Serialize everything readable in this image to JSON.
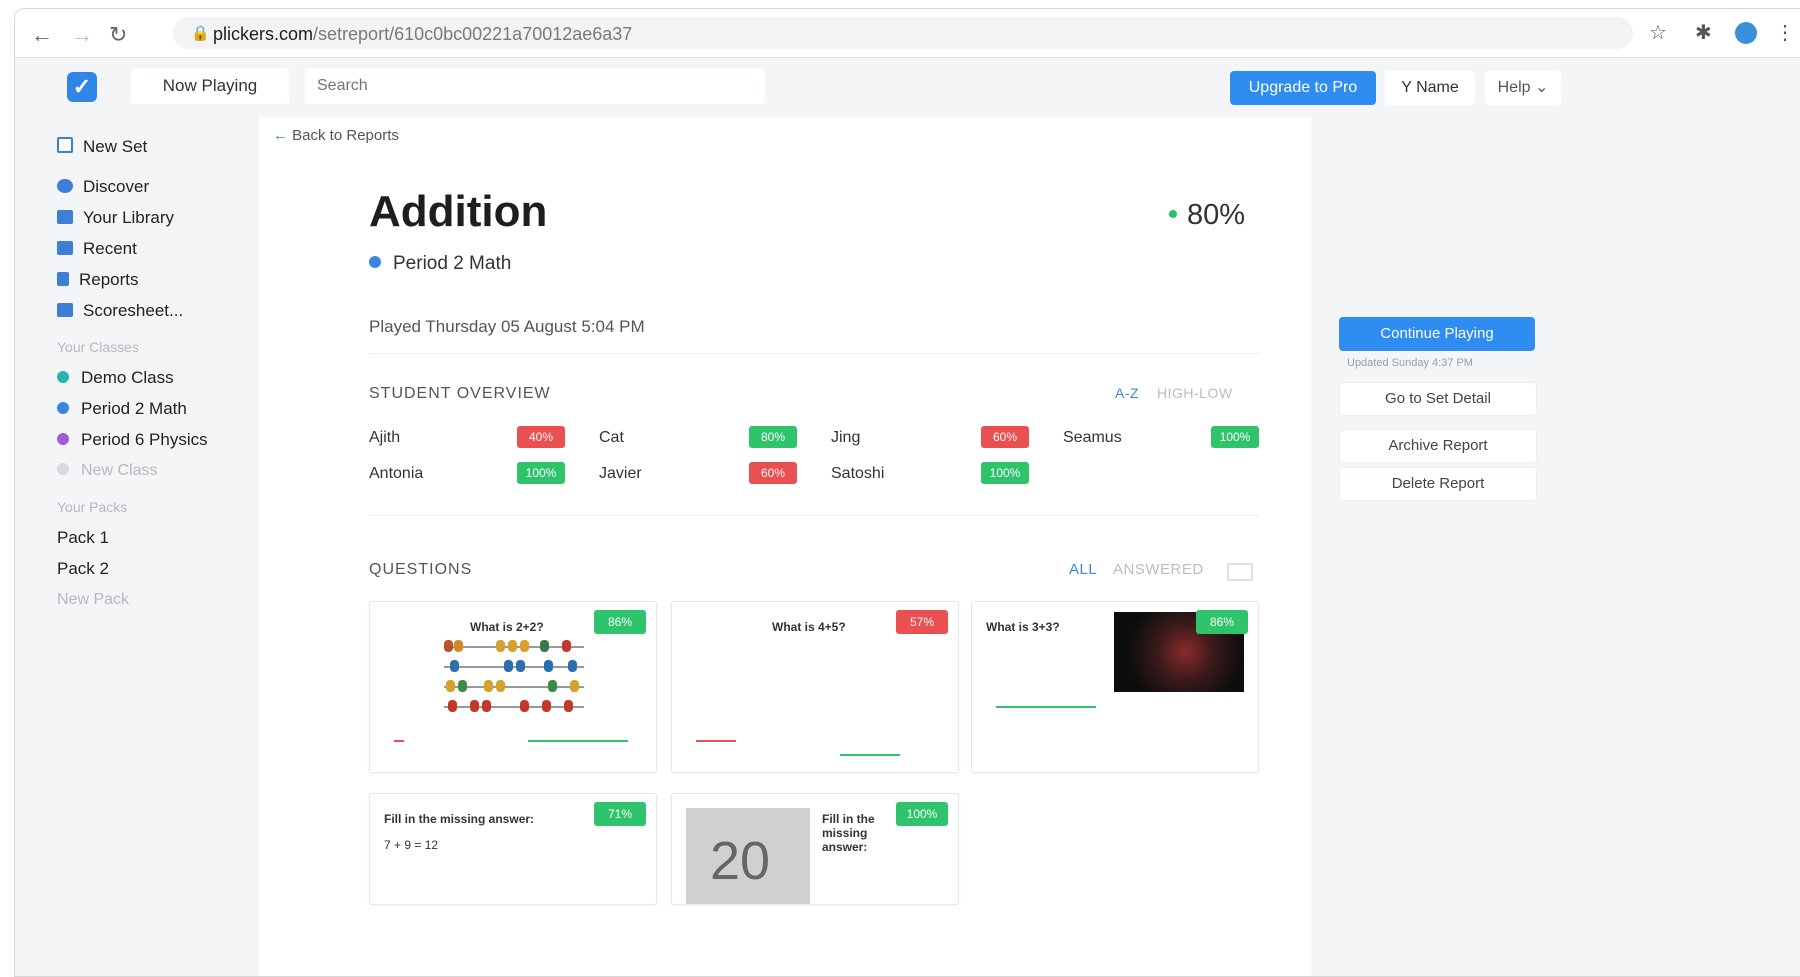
{
  "browser": {
    "url_host": "plickers.com",
    "url_path": "/setreport/610c0bc00221a70012ae6a37"
  },
  "topbar": {
    "now_playing": "Now Playing",
    "search_placeholder": "Search",
    "upgrade": "Upgrade to Pro",
    "user_name": "Y Name",
    "help": "Help"
  },
  "sidebar": {
    "new_set": "New Set",
    "items": [
      {
        "label": "Discover",
        "icon": "compass-icon"
      },
      {
        "label": "Your Library",
        "icon": "folder-icon"
      },
      {
        "label": "Recent",
        "icon": "clock-icon"
      },
      {
        "label": "Reports",
        "icon": "report-icon"
      },
      {
        "label": "Scoresheet...",
        "icon": "grid-icon"
      }
    ],
    "classes_heading": "Your Classes",
    "classes": [
      {
        "label": "Demo Class",
        "color": "#27b5a8"
      },
      {
        "label": "Period 2 Math",
        "color": "#3b86e0"
      },
      {
        "label": "Period 6 Physics",
        "color": "#a05bd6"
      }
    ],
    "new_class": "New Class",
    "packs_heading": "Your Packs",
    "packs": [
      "Pack 1",
      "Pack 2"
    ],
    "new_pack": "New Pack"
  },
  "report": {
    "back": "Back to Reports",
    "title": "Addition",
    "score": "80%",
    "class_name": "Period 2 Math",
    "played": "Played Thursday 05 August 5:04 PM",
    "overview_title": "STUDENT OVERVIEW",
    "sort_az": "A-Z",
    "sort_hl": "HIGH-LOW",
    "students": [
      {
        "name": "Ajith",
        "score": "40%",
        "status": "low"
      },
      {
        "name": "Cat",
        "score": "80%",
        "status": "high"
      },
      {
        "name": "Jing",
        "score": "60%",
        "status": "low"
      },
      {
        "name": "Seamus",
        "score": "100%",
        "status": "high"
      },
      {
        "name": "Antonia",
        "score": "100%",
        "status": "high"
      },
      {
        "name": "Javier",
        "score": "60%",
        "status": "low"
      },
      {
        "name": "Satoshi",
        "score": "100%",
        "status": "high"
      }
    ],
    "questions_title": "QUESTIONS",
    "filter_all": "ALL",
    "filter_answered": "ANSWERED",
    "questions": [
      {
        "title": "What is 2+2?",
        "score": "86%",
        "status": "high"
      },
      {
        "title": "What is 4+5?",
        "score": "57%",
        "status": "low"
      },
      {
        "title": "What is 3+3?",
        "score": "86%",
        "status": "high"
      },
      {
        "title": "Fill in the missing answer:",
        "body": "7 + 9 = 12",
        "score": "71%",
        "status": "high"
      },
      {
        "title": "Fill in the missing answer:",
        "score": "100%",
        "status": "high",
        "image_text": "20"
      }
    ]
  },
  "actions": {
    "continue": "Continue Playing",
    "updated": "Updated Sunday 4:37 PM",
    "set_detail": "Go to Set Detail",
    "archive": "Archive Report",
    "delete": "Delete Report"
  }
}
